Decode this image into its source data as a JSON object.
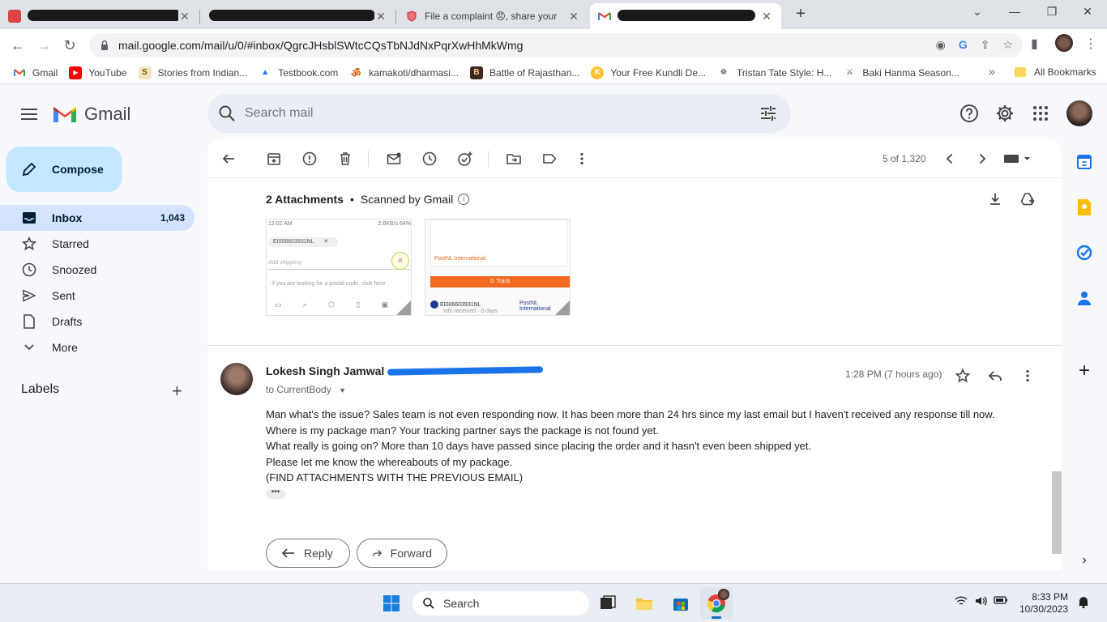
{
  "browser": {
    "tabs": [
      {
        "title": "",
        "redacted": true
      },
      {
        "title": "",
        "redacted": true
      },
      {
        "title": "File a complaint 😠, share your",
        "redacted": false
      },
      {
        "title": "",
        "redacted": true
      }
    ],
    "new_tab_label": "+",
    "url": "mail.google.com/mail/u/0/#inbox/QgrcJHsblSWtcCQsTbNJdNxPqrXwHhMkWmg",
    "bookmarks": [
      {
        "label": "Gmail",
        "icon": "gmail-icon"
      },
      {
        "label": "YouTube",
        "icon": "youtube-icon"
      },
      {
        "label": "Stories from Indian...",
        "icon": "stories-icon"
      },
      {
        "label": "Testbook.com",
        "icon": "testbook-icon"
      },
      {
        "label": "kamakoti/dharmasi...",
        "icon": "om-icon"
      },
      {
        "label": "Battle of Rajasthan...",
        "icon": "battle-icon"
      },
      {
        "label": "Your Free Kundli De...",
        "icon": "kundli-icon"
      },
      {
        "label": "Tristan Tate Style: H...",
        "icon": "tristan-icon"
      },
      {
        "label": "Baki Hanma Season...",
        "icon": "baki-icon"
      }
    ],
    "all_bookmarks_label": "All Bookmarks",
    "more_bookmarks_label": "»"
  },
  "gmail": {
    "logo_text": "Gmail",
    "search_placeholder": "Search mail",
    "compose_label": "Compose",
    "nav": [
      {
        "label": "Inbox",
        "count": "1,043",
        "icon": "inbox-icon",
        "active": true
      },
      {
        "label": "Starred",
        "count": "",
        "icon": "star-icon",
        "active": false
      },
      {
        "label": "Snoozed",
        "count": "",
        "icon": "clock-icon",
        "active": false
      },
      {
        "label": "Sent",
        "count": "",
        "icon": "send-icon",
        "active": false
      },
      {
        "label": "Drafts",
        "count": "",
        "icon": "draft-icon",
        "active": false
      },
      {
        "label": "More",
        "count": "",
        "icon": "chevron-down-icon",
        "active": false
      }
    ],
    "labels_heading": "Labels",
    "pager": "5 of 1,320"
  },
  "thread": {
    "attachments": {
      "count_label": "2 Attachments",
      "separator": "•",
      "scanned_label": "Scanned by Gmail",
      "thumb1": {
        "time": "12:02 AM",
        "status": "2.6KB/s",
        "battery": "64%",
        "tracking_id": "EI006603931NL",
        "placeholder": "Add shipping",
        "postal_hint": "If you are looking for a postal code, click here"
      },
      "thumb2": {
        "carrier": "PostNL International",
        "track_label": "Track",
        "tracking_id": "EI006603931NL",
        "carrier_short": "PostNL International",
        "info": "Info received · 0 days"
      }
    },
    "message": {
      "sender_name": "Lokesh Singh Jamwal",
      "to_line": "to CurrentBody",
      "time": "1:28 PM (7 hours ago)",
      "body": [
        "Man what's the issue? Sales team is not even responding now. It has been more than 24 hrs since my last email but I haven't received any response till now.",
        "Where is my package man? Your tracking partner says the package is not found yet.",
        "What really is going on? More than 10 days have passed since placing the order and it hasn't even been shipped yet.",
        "Please let me know the whereabouts of my package.",
        "(FIND ATTACHMENTS WITH THE PREVIOUS EMAIL)"
      ],
      "ellipsis": "•••"
    },
    "reply_label": "Reply",
    "forward_label": "Forward"
  },
  "taskbar": {
    "search_label": "Search",
    "time": "8:33 PM",
    "date": "10/30/2023"
  },
  "colors": {
    "accent": "#0b57d0",
    "compose_bg": "#c2e7ff",
    "active_nav": "#d3e3fd",
    "gmail_red": "#ea4335"
  }
}
